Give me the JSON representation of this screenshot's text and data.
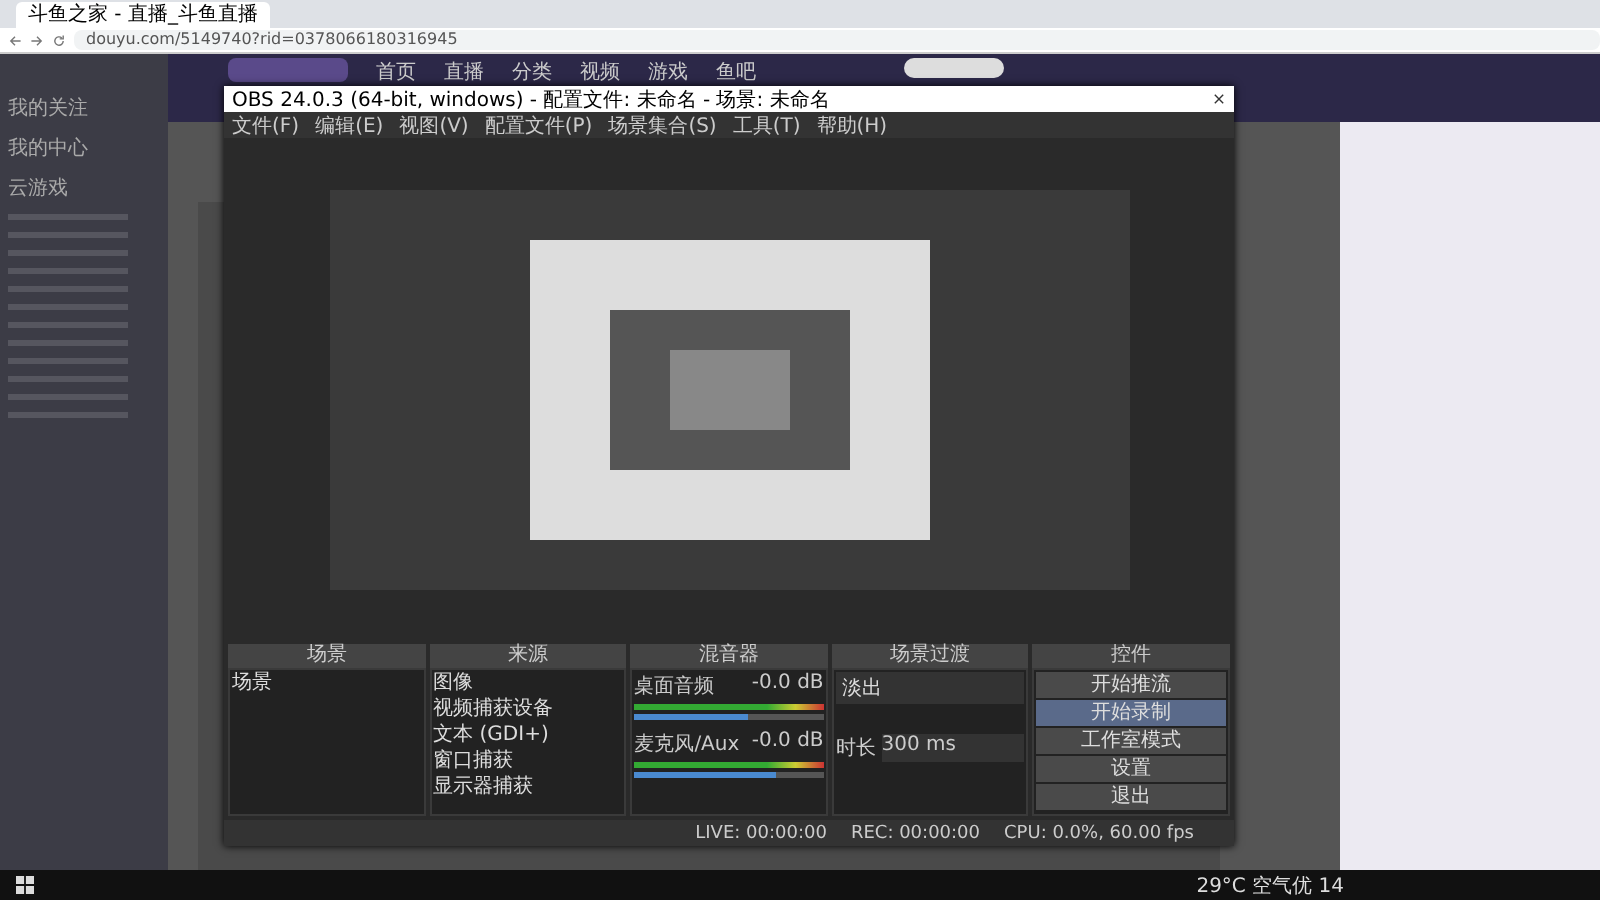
{
  "browser": {
    "tab_title": "斗鱼之家 - 直播_斗鱼直播",
    "url": "douyu.com/5149740?rid=0378066180316945"
  },
  "site": {
    "nav": [
      "首页",
      "直播",
      "分类",
      "视频",
      "游戏",
      "鱼吧"
    ],
    "sidebar": [
      "我的关注",
      "我的中心",
      "云游戏"
    ]
  },
  "obs": {
    "title": "OBS 24.0.3 (64-bit, windows) - 配置文件: 未命名 - 场景: 未命名",
    "menu": [
      "文件(F)",
      "编辑(E)",
      "视图(V)",
      "配置文件(P)",
      "场景集合(S)",
      "工具(T)",
      "帮助(H)"
    ],
    "docks": [
      "场景",
      "来源",
      "混音器",
      "场景过渡",
      "控件"
    ],
    "scenes": [
      {
        "label": "场景",
        "selected": false
      }
    ],
    "sources": [
      "图像",
      "视频捕获设备",
      "文本 (GDI+)",
      "窗口捕获",
      "显示器捕获"
    ],
    "mixer": [
      {
        "name": "桌面音频",
        "reading": "-0.0 dB",
        "level": 0.6
      },
      {
        "name": "麦克风/Aux",
        "reading": "-0.0 dB",
        "level": 0.75
      }
    ],
    "transition": {
      "value": "淡出",
      "duration_label": "时长",
      "duration": "300 ms"
    },
    "controls": [
      {
        "label": "开始推流",
        "selected": false
      },
      {
        "label": "开始录制",
        "selected": true
      },
      {
        "label": "工作室模式",
        "selected": false
      },
      {
        "label": "设置",
        "selected": false
      },
      {
        "label": "退出",
        "selected": false
      }
    ],
    "status": [
      "LIVE: 00:00:00",
      "REC: 00:00:00",
      "CPU: 0.0%, 60.00 fps"
    ]
  },
  "taskbar": {
    "weather": "29°C 空气优 14"
  }
}
